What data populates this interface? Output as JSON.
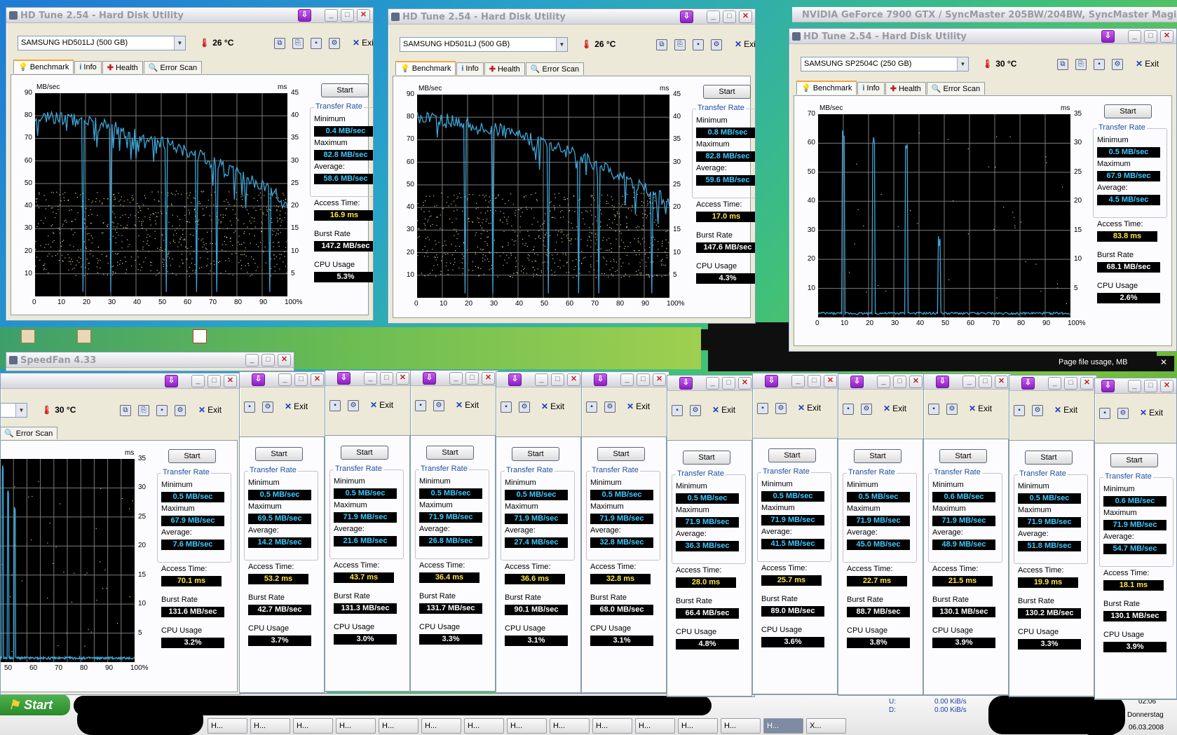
{
  "small_app_title": "HD Tune 2.54 - Hard Disk Utility",
  "nvidia_title": "NVIDIA GeForce 7900 GTX / SyncMaster 205BW/204BW, SyncMaster Magic ...",
  "speedfan_title": "SpeedFan 4.33",
  "page_file_label": "Page file usage, MB",
  "main_windows": [
    {
      "title": "HD Tune 2.54 - Hard Disk Utility",
      "drive": "SAMSUNG HD501LJ (500 GB)",
      "temp": "26 °C",
      "min": "0.4 MB/sec",
      "max": "82.8 MB/sec",
      "avg": "58.6 MB/sec",
      "access": "16.9 ms",
      "burst": "147.2 MB/sec",
      "cpu": "5.3%"
    },
    {
      "title": "HD Tune 2.54 - Hard Disk Utility",
      "drive": "SAMSUNG HD501LJ (500 GB)",
      "temp": "26 °C",
      "min": "0.8 MB/sec",
      "max": "82.8 MB/sec",
      "avg": "59.6 MB/sec",
      "access": "17.0 ms",
      "burst": "147.6 MB/sec",
      "cpu": "4.3%"
    },
    {
      "title": "HD Tune 2.54 - Hard Disk Utility",
      "drive": "SAMSUNG SP2504C (250 GB)",
      "temp": "30 °C",
      "min": "0.5 MB/sec",
      "max": "67.9 MB/sec",
      "avg": "4.5 MB/sec",
      "access": "83.8 ms",
      "burst": "68.1 MB/sec",
      "cpu": "2.6%"
    }
  ],
  "labels": {
    "start": "Start",
    "transfer_rate": "Transfer Rate",
    "minimum": "Minimum",
    "maximum": "Maximum",
    "average": "Average:",
    "access_time": "Access Time:",
    "burst_rate": "Burst Rate",
    "cpu_usage": "CPU Usage",
    "exit": "Exit",
    "mbsec": "MB/sec",
    "ms": "ms",
    "tab_benchmark": "Benchmark",
    "tab_info": "Info",
    "tab_health": "Health",
    "tab_error": "Error Scan"
  },
  "axis": {
    "x_ticks": [
      "0",
      "10",
      "20",
      "30",
      "40",
      "50",
      "60",
      "70",
      "80",
      "90",
      "100%"
    ],
    "left_ticks_90": [
      "90",
      "80",
      "70",
      "60",
      "50",
      "40",
      "30",
      "20",
      "10"
    ],
    "right_ticks_45": [
      "45",
      "40",
      "35",
      "30",
      "25",
      "20",
      "15",
      "10",
      "5"
    ],
    "left_ticks_70": [
      "70",
      "60",
      "50",
      "40",
      "30",
      "20",
      "10"
    ],
    "right_ticks_35": [
      "35",
      "30",
      "25",
      "20",
      "15",
      "10",
      "5"
    ],
    "partial_x_ticks": [
      "50",
      "60",
      "70",
      "80",
      "90",
      "100%"
    ]
  },
  "strip_windows": [
    {
      "temp": "30 °C",
      "min": "0.5 MB/sec",
      "max": "67.9 MB/sec",
      "avg": "7.6 MB/sec",
      "access": "70.1 ms",
      "burst": "131.6 MB/sec",
      "cpu": "3.2%"
    },
    {
      "min": "0.5 MB/sec",
      "max": "69.5 MB/sec",
      "avg": "14.2 MB/sec",
      "access": "53.2 ms",
      "burst": "42.7 MB/sec",
      "cpu": "3.7%"
    },
    {
      "min": "0.5 MB/sec",
      "max": "71.9 MB/sec",
      "avg": "21.6 MB/sec",
      "access": "43.7 ms",
      "burst": "131.3 MB/sec",
      "cpu": "3.0%"
    },
    {
      "min": "0.5 MB/sec",
      "max": "71.9 MB/sec",
      "avg": "26.8 MB/sec",
      "access": "36.4 ms",
      "burst": "131.7 MB/sec",
      "cpu": "3.3%"
    },
    {
      "min": "0.5 MB/sec",
      "max": "71.9 MB/sec",
      "avg": "27.4 MB/sec",
      "access": "36.6 ms",
      "burst": "90.1 MB/sec",
      "cpu": "3.1%"
    },
    {
      "min": "0.5 MB/sec",
      "max": "71.9 MB/sec",
      "avg": "32.8 MB/sec",
      "access": "32.8 ms",
      "burst": "68.0 MB/sec",
      "cpu": "3.1%"
    },
    {
      "min": "0.5 MB/sec",
      "max": "71.9 MB/sec",
      "avg": "36.3 MB/sec",
      "access": "28.0 ms",
      "burst": "66.4 MB/sec",
      "cpu": "4.8%"
    },
    {
      "min": "0.5 MB/sec",
      "max": "71.9 MB/sec",
      "avg": "41.5 MB/sec",
      "access": "25.7 ms",
      "burst": "89.0 MB/sec",
      "cpu": "3.6%"
    },
    {
      "min": "0.5 MB/sec",
      "max": "71.9 MB/sec",
      "avg": "45.0 MB/sec",
      "access": "22.7 ms",
      "burst": "88.7 MB/sec",
      "cpu": "3.8%"
    },
    {
      "min": "0.6 MB/sec",
      "max": "71.9 MB/sec",
      "avg": "48.9 MB/sec",
      "access": "21.5 ms",
      "burst": "130.1 MB/sec",
      "cpu": "3.9%"
    },
    {
      "min": "0.5 MB/sec",
      "max": "71.9 MB/sec",
      "avg": "51.8 MB/sec",
      "access": "19.9 ms",
      "burst": "130.2 MB/sec",
      "cpu": "3.3%"
    },
    {
      "min": "0.6 MB/sec",
      "max": "71.9 MB/sec",
      "avg": "54.7 MB/sec",
      "access": "18.1 ms",
      "burst": "130.1 MB/sec",
      "cpu": "3.9%"
    }
  ],
  "taskbar": {
    "start": "Start",
    "items": [
      "H...",
      "H...",
      "H...",
      "H...",
      "H...",
      "H...",
      "H...",
      "H...",
      "H...",
      "H...",
      "H...",
      "H...",
      "H...",
      "H...",
      "X..."
    ],
    "net_u_label": "U:",
    "net_d_label": "D:",
    "net_u": "0.00 KiB/s",
    "net_d": "0.00 KiB/s",
    "time": "02:06",
    "day": "Donnerstag",
    "date": "06.03.2008"
  },
  "colors": {
    "chart_bg": "#000000",
    "grid": "#7a7a7a",
    "trace": "#3da6d8",
    "dots": "#d6d08a",
    "value_blue": "#3ec9ff",
    "value_yellow": "#ffe640"
  }
}
